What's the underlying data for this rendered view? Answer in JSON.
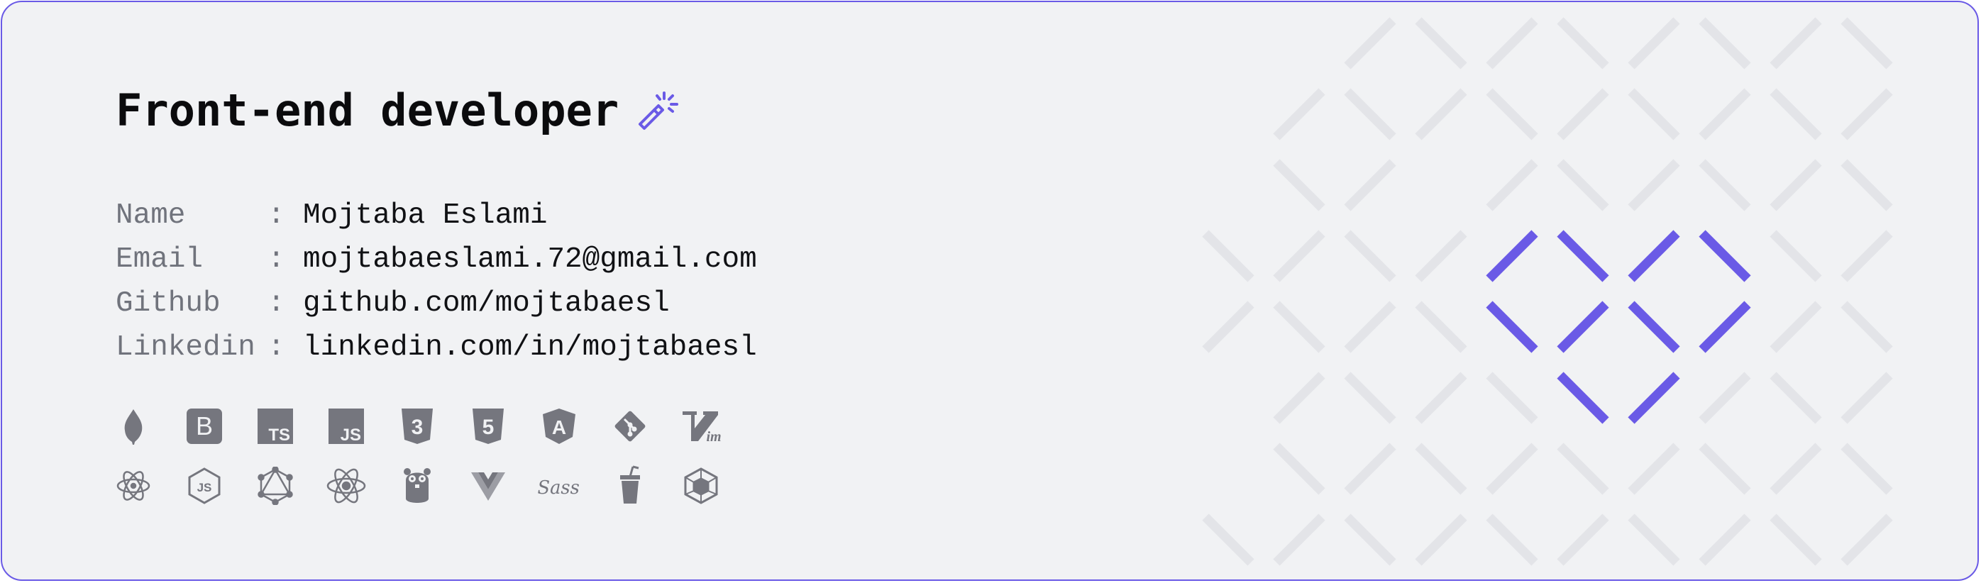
{
  "header": {
    "title": "Front-end developer",
    "title_icon": "magic-wand-icon"
  },
  "info": [
    {
      "label": "Name",
      "separator": ":",
      "value": "Mojtaba Eslami"
    },
    {
      "label": "Email",
      "separator": ":",
      "value": "mojtabaeslami.72@gmail.com"
    },
    {
      "label": "Github",
      "separator": ":",
      "value": "github.com/mojtabaesl"
    },
    {
      "label": "Linkedin",
      "separator": ":",
      "value": "linkedin.com/in/mojtabaesl"
    }
  ],
  "tech_icons": {
    "row1": [
      "mongodb-icon",
      "bootstrap-icon",
      "typescript-icon",
      "javascript-icon",
      "css3-icon",
      "html5-icon",
      "angular-icon",
      "git-icon",
      "vim-icon"
    ],
    "row2": [
      "electron-icon",
      "nodejs-icon",
      "graphql-icon",
      "react-icon",
      "golang-gopher-icon",
      "vue-icon",
      "sass-icon",
      "gulp-icon",
      "webpack-icon"
    ],
    "labels": {
      "bootstrap": "B",
      "typescript": "TS",
      "javascript": "JS",
      "css3": "3",
      "html5": "5",
      "angular": "A",
      "vim": "im",
      "nodejs": "JS",
      "sass": "Sass"
    }
  },
  "colors": {
    "accent": "#6a5ae6",
    "card_background": "#f1f2f4",
    "pattern": "#e3e4e8",
    "icon": "#75767e",
    "title": "#0b0b0d",
    "label": "#70737c"
  }
}
